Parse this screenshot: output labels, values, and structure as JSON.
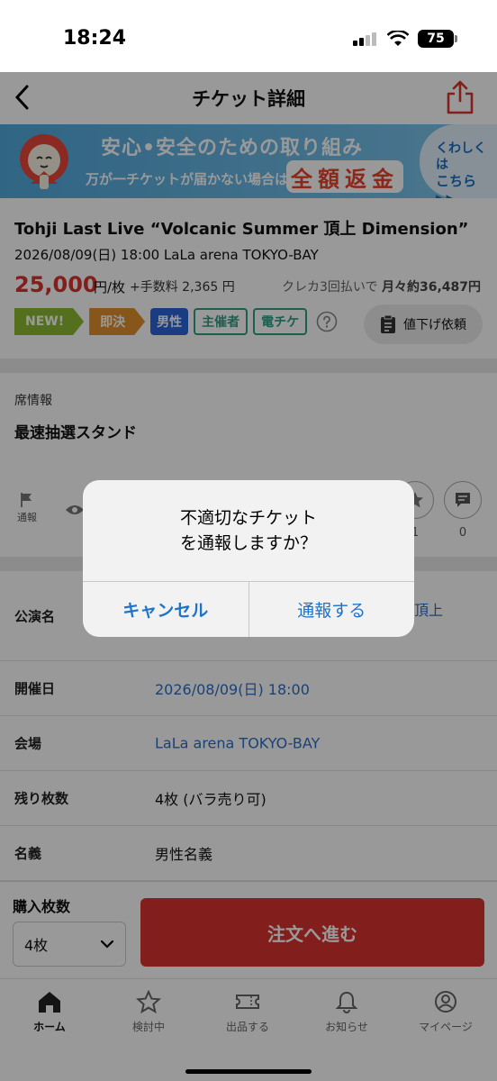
{
  "status_bar": {
    "time": "18:24",
    "battery": "75"
  },
  "nav": {
    "title": "チケット詳細",
    "back_icon": "chevron-left-icon",
    "share_icon": "share-icon"
  },
  "banner": {
    "title": "安心•安全のための取り組み",
    "subtitle": "万が一チケットが届かない場合は",
    "refund": "全額返金",
    "link_line1": "くわしくは",
    "link_line2": "こちら ▶▶"
  },
  "ticket": {
    "title": "Tohji Last Live “Volcanic Summer 頂上 Dimension”",
    "date_venue": "2026/08/09(日) 18:00 LaLa arena TOKYO-BAY",
    "price": "25,000",
    "price_unit": "円/枚",
    "fee": "+手数料 2,365 円",
    "installment_prefix": "クレカ3回払いで",
    "installment_amount": "月々約36,487円",
    "tags": {
      "new": "NEW!",
      "quick": "即決",
      "male": "男性",
      "organizer": "主催者",
      "e_ticket": "電チケ"
    },
    "price_cut_button": "値下げ依頼"
  },
  "seat": {
    "label": "席情報",
    "value": "最速抽選スタンド"
  },
  "actions": {
    "report_label": "通報",
    "star_count": "1",
    "comment_count": "0"
  },
  "info": {
    "performance_label": "公演名",
    "performance_value": "頂上",
    "date_label": "開催日",
    "date_value": "2026/08/09(日) 18:00",
    "venue_label": "会場",
    "venue_value": "LaLa arena TOKYO-BAY",
    "remaining_label": "残り枚数",
    "remaining_value": "4枚 (バラ売り可)",
    "holder_label": "名義",
    "holder_value": "男性名義"
  },
  "purchase": {
    "qty_label": "購入枚数",
    "qty_value": "4枚",
    "order_button": "注文へ進む"
  },
  "tabs": [
    {
      "label": "ホーム",
      "icon": "home-icon"
    },
    {
      "label": "検討中",
      "icon": "star-icon"
    },
    {
      "label": "出品する",
      "icon": "ticket-icon"
    },
    {
      "label": "お知らせ",
      "icon": "bell-icon"
    },
    {
      "label": "マイページ",
      "icon": "user-icon"
    }
  ],
  "dialog": {
    "title": "不適切なチケット\nを通報しますか？",
    "cancel": "キャンセル",
    "confirm": "通報する"
  },
  "colors": {
    "accent_red": "#d9322d",
    "link_blue": "#2d6fc4",
    "dialog_button": "#1f73c9",
    "banner_blue": "#51a9dd"
  }
}
